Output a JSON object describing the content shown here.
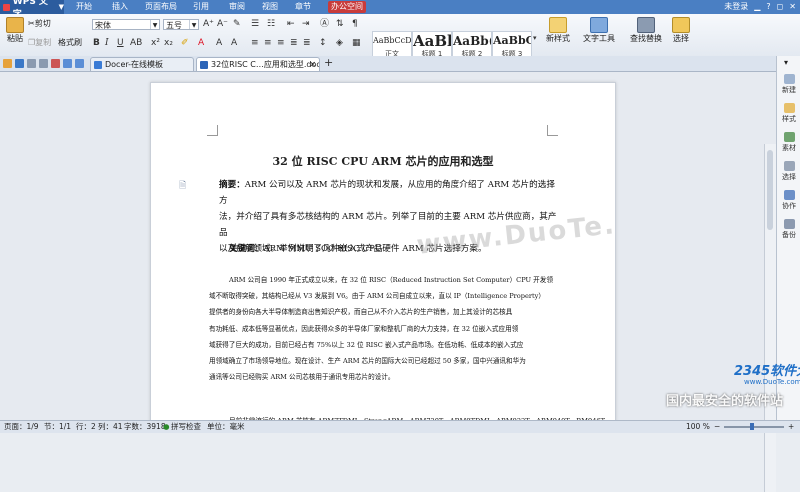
{
  "app": {
    "name": "WPS 文字",
    "login": "未登录"
  },
  "menu": {
    "items": [
      "开始",
      "插入",
      "页面布局",
      "引用",
      "审阅",
      "视图",
      "章节"
    ],
    "office_tab": "办公空间"
  },
  "ribbon": {
    "paste": "粘贴",
    "cut": "剪切",
    "copy": "复制",
    "format_painter": "格式刷",
    "font_name": "宋体",
    "font_size": "五号",
    "styles": [
      {
        "sample": "AaBbCcDd",
        "label": "正文"
      },
      {
        "sample": "AaBl",
        "label": "标题 1"
      },
      {
        "sample": "AaBb(",
        "label": "标题 2"
      },
      {
        "sample": "AaBbC",
        "label": "标题 3"
      }
    ],
    "new_style": "新样式",
    "text_tools": "文字工具",
    "find_replace": "查找替换",
    "select": "选择"
  },
  "tabs": [
    {
      "label": "Docer-在线模板",
      "active": false
    },
    {
      "label": "32位RISC C…应用和选型.doc",
      "active": true
    }
  ],
  "document": {
    "title": "32 位 RISC CPU ARM 芯片的应用和选型",
    "abstract_label": "摘要：",
    "abstract_lines": [
      "ARM 公司以及 ARM 芯片的现状和发展，从应用的角度介绍了 ARM 芯片的选择方",
      "法，并介绍了具有多芯核结构的 ARM 芯片。列举了目前的主要 ARM 芯片供应商，其产品",
      "以及应用领域。举例说明了几种嵌入式产品硬件 ARM 芯片选择方案。"
    ],
    "keywords_label": "关键词：",
    "keywords": "ARM MMU SOC RISC CPU",
    "body_lines": [
      "ARM 公司自 1990 年正式成立以来，在 32 位 RISC（Reduced Instruction Set Computer）CPU 开发领",
      "域不断取得突破，其结构已经从 V3 发展到 V6。由于 ARM 公司自成立以来，直以 IP（Intelligence Property）",
      "提供者的身份向各大半导体制造商出售知识产权，而自己从不介入芯片的生产销售，加上其设计的芯核具",
      "有功耗低、成本低等显著优点，因此获得众多的半导体厂家和整机厂商的大力支持，在 32 位嵌入式应用领",
      "域获得了巨大的成功，目前已经占有 75%以上 32 位 RISC 嵌入式产品市场。在低功耗、低成本的嵌入式应",
      "用领域确立了市场领导地位。现在设计、生产 ARM 芯片的国际大公司已经超过 50 多家，国中兴通讯和华为",
      "通讯等公司已经购买 ARM 公司芯核用于通讯专用芯片的设计。"
    ],
    "last_line": "目前非常流行的 ARM 芯核有 ARM7TDMI，StrongARM，ARM720T，ARM9TDMI，ARM922T，ARM940T，RM946T，"
  },
  "watermark": "www.DuoTe.com",
  "right_panel": [
    "新建",
    "样式",
    "素材",
    "选择",
    "协作",
    "备份"
  ],
  "status": {
    "page": "页面：1/9",
    "section": "节：1/1",
    "row": "行：2",
    "col": "列：41",
    "words": "字数：3918",
    "spell": "拼写检查",
    "unit": "单位：毫米",
    "zoom": "100 %"
  },
  "brand": {
    "name": "2345软件大全",
    "site": "www.DuoTe.com",
    "slogan": "国内最安全的软件站"
  },
  "colors": {
    "menubar": "#4a7fc3",
    "office_tab": "#c83b3b",
    "brand_blue": "#1f6fc7"
  }
}
